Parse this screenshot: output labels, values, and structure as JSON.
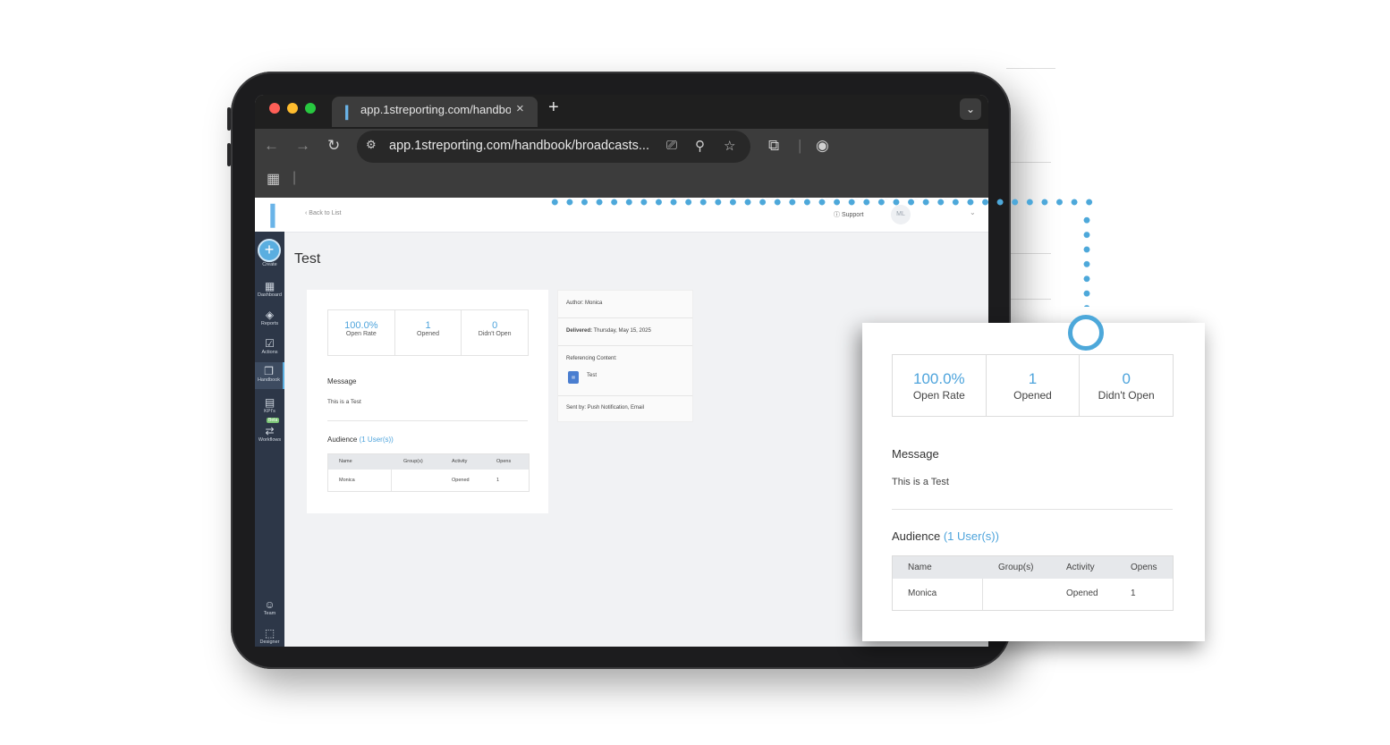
{
  "browser": {
    "tab_title": "app.1streporting.com/handbo",
    "tab_close": "×",
    "new_tab": "+",
    "tabs_dropdown": "⌄",
    "url": "app.1streporting.com/handbook/broadcasts...",
    "icons": [
      "back-arrow-icon",
      "forward-arrow-icon",
      "reload-icon",
      "site-settings-icon",
      "install-app-icon",
      "zoom-icon",
      "bookmark-star-icon",
      "extensions-icon",
      "profile-icon",
      "apps-grid-icon"
    ]
  },
  "sidebar": {
    "items": [
      {
        "label": "Create",
        "icon": "plus-icon"
      },
      {
        "label": "Dashboard",
        "icon": "grid-icon"
      },
      {
        "label": "Reports",
        "icon": "layers-icon"
      },
      {
        "label": "Actions",
        "icon": "checklist-icon"
      },
      {
        "label": "Handbook",
        "icon": "book-icon",
        "active": true
      },
      {
        "label": "KPI's",
        "icon": "kpi-icon"
      },
      {
        "label": "Workflows",
        "icon": "workflow-icon",
        "badge": "Beta"
      },
      {
        "label": "Team",
        "icon": "team-icon"
      },
      {
        "label": "Designer",
        "icon": "designer-icon"
      }
    ]
  },
  "topbar": {
    "back_link": "‹ Back to List",
    "support": "Support",
    "avatar_initials": "ML",
    "dropdown": "⌄"
  },
  "page": {
    "title": "Test"
  },
  "stats": [
    {
      "value": "100.0%",
      "label": "Open Rate"
    },
    {
      "value": "1",
      "label": "Opened"
    },
    {
      "value": "0",
      "label": "Didn't Open"
    }
  ],
  "message": {
    "heading": "Message",
    "body": "This is a Test"
  },
  "audience": {
    "heading": "Audience",
    "users_link": "(1 User(s))",
    "columns": [
      "Name",
      "Group(s)",
      "Activity",
      "Opens"
    ],
    "rows": [
      {
        "name": "Monica",
        "groups": "",
        "activity": "Opened",
        "opens": "1"
      }
    ]
  },
  "info": {
    "author": "Author: Monica",
    "delivered_label": "Delivered:",
    "delivered_value": "Thursday, May 15, 2025",
    "referencing_label": "Referencing Content:",
    "referencing_item": "Test",
    "referencing_icon": "document-icon",
    "sent_by": "Sent by: Push Notification, Email"
  },
  "colors": {
    "accent": "#4ea4dc",
    "connector": "#4da8da",
    "sidebar": "#2d3748"
  }
}
